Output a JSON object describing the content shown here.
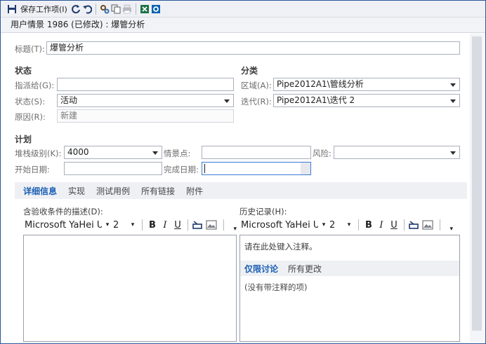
{
  "toolbar": {
    "save_label": "保存工作项(I)",
    "icons": [
      "save-icon",
      "refresh-icon",
      "undo-icon",
      "process-icon",
      "copy-icon",
      "print-icon",
      "excel-icon",
      "outlook-icon"
    ]
  },
  "title": "用户情景 1986 (已修改) : 爆管分析",
  "form": {
    "title_label": "标题(T):",
    "title_value": "爆管分析",
    "status_section": "状态",
    "assigned_label": "指派给(G):",
    "assigned_value": "",
    "state_label": "状态(S):",
    "state_value": "活动",
    "reason_label": "原因(R):",
    "reason_value": "新建",
    "class_section": "分类",
    "area_label": "区域(A):",
    "area_value": "Pipe2012A1\\管线分析",
    "iteration_label": "迭代(R):",
    "iteration_value": "Pipe2012A1\\迭代 2",
    "plan_section": "计划",
    "stack_rank_label": "堆栈级别(K):",
    "stack_rank_value": "4000",
    "story_points_label": "情景点:",
    "story_points_value": "",
    "risk_label": "风险:",
    "risk_value": "",
    "start_label": "开始日期:",
    "start_value": "",
    "finish_label": "完成日期:",
    "finish_value": ""
  },
  "tabs": [
    "详细信息",
    "实现",
    "测试用例",
    "所有链接",
    "附件"
  ],
  "acceptance": {
    "label": "含验收条件的描述(D):",
    "font": "Microsoft YaHei U",
    "size": "2"
  },
  "history": {
    "label": "历史记录(H):",
    "font": "Microsoft YaHei U",
    "size": "2",
    "placeholder": "请在此处键入注释。",
    "tab_discussion": "仅限讨论",
    "tab_all": "所有更改",
    "empty_text": "(没有带注释的项)"
  },
  "colors": {
    "accent": "#1a5fb4",
    "frame": "#2b5797"
  }
}
